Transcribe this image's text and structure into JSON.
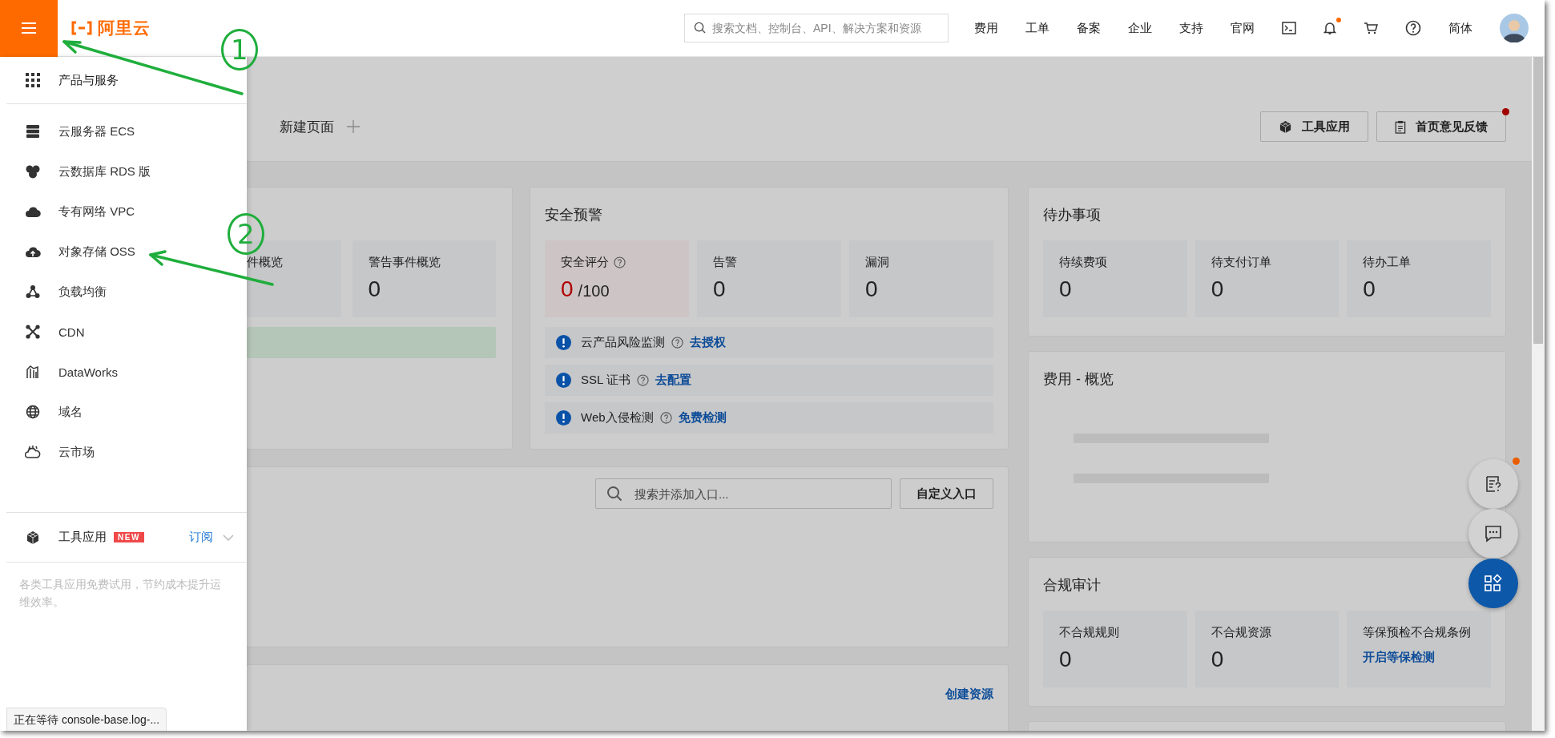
{
  "topbar": {
    "logo": "阿里云",
    "search": {
      "placeholder": "搜索文档、控制台、API、解决方案和资源"
    },
    "nav": [
      "费用",
      "工单",
      "备案",
      "企业",
      "支持",
      "官网"
    ],
    "bell": {
      "unread": true
    },
    "language": "简体"
  },
  "sidebar": {
    "header": {
      "label": "产品与服务"
    },
    "items": [
      {
        "label": "云服务器 ECS",
        "kind": "server"
      },
      {
        "label": "云数据库 RDS 版",
        "kind": "database"
      },
      {
        "label": "专有网络 VPC",
        "kind": "network"
      },
      {
        "label": "对象存储 OSS",
        "kind": "storage"
      },
      {
        "label": "负载均衡",
        "kind": "balancer"
      },
      {
        "label": "CDN",
        "kind": "cdn"
      },
      {
        "label": "DataWorks",
        "kind": "dataworks"
      },
      {
        "label": "域名",
        "kind": "globe"
      },
      {
        "label": "云市场",
        "kind": "market"
      }
    ],
    "tools": {
      "label": "工具应用",
      "badge": "NEW",
      "link": "订阅",
      "expanded": false,
      "description": "各类工具应用免费试用，节约成本提升运维效率。"
    }
  },
  "page_tab": {
    "label": "新建页面"
  },
  "header_buttons": [
    {
      "label": "工具应用",
      "kind": "cube",
      "unread": false
    },
    {
      "label": "首页意见反馈",
      "kind": "clipboard",
      "unread": true
    }
  ],
  "event_card": {
    "tiles": [
      {
        "label": "件概览"
      },
      {
        "label": "警告事件概览",
        "value": "0"
      }
    ]
  },
  "security_card": {
    "title": "安全预警",
    "tiles": [
      {
        "label": "安全评分",
        "help": true,
        "alert": true,
        "value": "0",
        "suffix": "/100"
      },
      {
        "label": "告警",
        "help": false,
        "alert": false,
        "value": "0"
      },
      {
        "label": "漏洞",
        "help": false,
        "alert": false,
        "value": "0"
      }
    ],
    "alerts": [
      {
        "text": "云产品风险监测",
        "link": "去授权"
      },
      {
        "text": "SSL 证书",
        "link": "去配置"
      },
      {
        "text": "Web入侵检测",
        "link": "免费检测"
      }
    ]
  },
  "entry_card": {
    "search": {
      "placeholder": "搜索并添加入口..."
    },
    "button": "自定义入口"
  },
  "resource_card": {
    "link": "创建资源"
  },
  "todo_card": {
    "title": "待办事项",
    "tiles": [
      {
        "label": "待续费项",
        "value": "0"
      },
      {
        "label": "待支付订单",
        "value": "0"
      },
      {
        "label": "待办工单",
        "value": "0"
      }
    ]
  },
  "cost_card": {
    "title": "费用 - 概览"
  },
  "compliance_card": {
    "title": "合规审计",
    "tiles": [
      {
        "label": "不合规规则",
        "value": "0"
      },
      {
        "label": "不合规资源",
        "value": "0"
      },
      {
        "label": "等保预检不合规条例",
        "link": "开启等保检测"
      }
    ]
  },
  "float_buttons": [
    {
      "kind": "faq",
      "unread": true
    },
    {
      "kind": "chat",
      "unread": false
    },
    {
      "kind": "apps",
      "unread": false
    }
  ],
  "status": "正在等待 console-base.log-...",
  "annotations": [
    {
      "label": "1"
    },
    {
      "label": "2"
    }
  ]
}
